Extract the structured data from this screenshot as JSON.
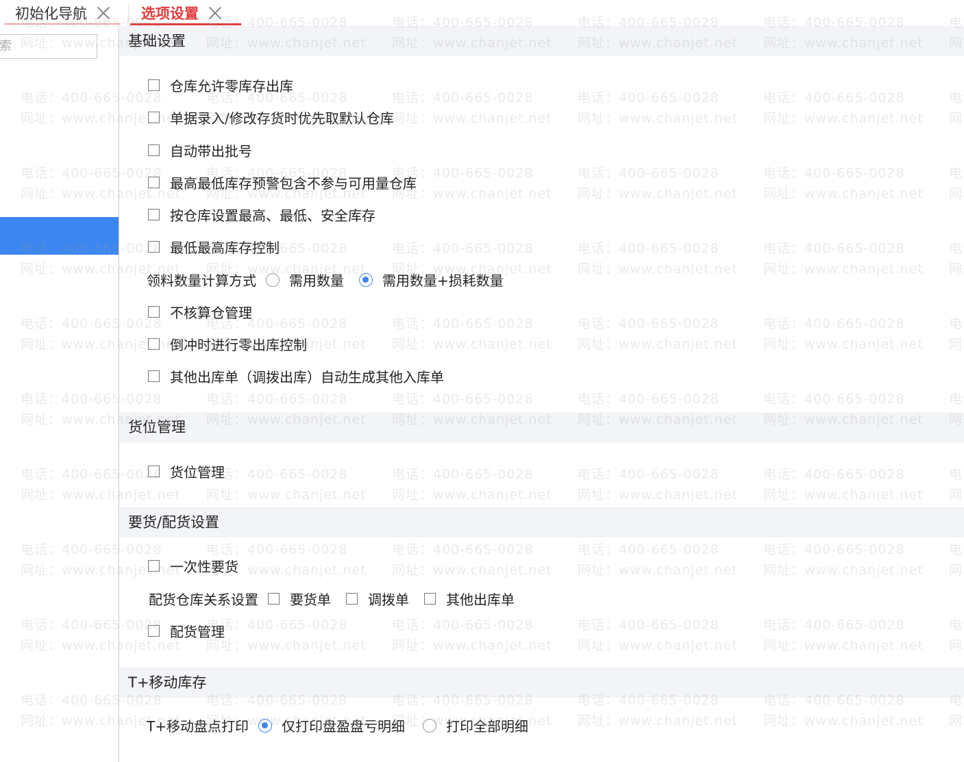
{
  "tabs": [
    {
      "label": "初始化导航"
    },
    {
      "label": "选项设置"
    }
  ],
  "sidebar": {
    "search_placeholder": "索"
  },
  "sections": {
    "basic": {
      "title": "基础设置",
      "options": [
        "仓库允许零库存出库",
        "单据录入/修改存货时优先取默认仓库",
        "自动带出批号",
        "最高最低库存预警包含不参与可用量仓库",
        "按仓库设置最高、最低、安全库存",
        "最低最高库存控制"
      ],
      "calc_method": {
        "label": "领料数量计算方式",
        "options": [
          "需用数量",
          "需用数量+损耗数量"
        ],
        "selected": "需用数量+损耗数量"
      },
      "options2": [
        "不核算仓管理",
        "倒冲时进行零出库控制",
        "其他出库单（调拨出库）自动生成其他入库单"
      ]
    },
    "location": {
      "title": "货位管理",
      "options": [
        "货位管理"
      ]
    },
    "requisition": {
      "title": "要货/配货设置",
      "options": [
        "一次性要货"
      ],
      "relation": {
        "label": "配货仓库关系设置",
        "options": [
          "要货单",
          "调拨单",
          "其他出库单"
        ]
      },
      "options2": [
        "配货管理"
      ]
    },
    "mobile": {
      "title": "T+移动库存",
      "print": {
        "label": "T+移动盘点打印",
        "options": [
          "仅打印盘盈盘亏明细",
          "打印全部明细"
        ],
        "selected": "仅打印盘盈盘亏明细"
      }
    }
  },
  "watermark": {
    "phone": "电话：400-665-0028",
    "site": "网址：www.chanjet.net"
  },
  "colors": {
    "accent": "#3b86f0",
    "active_tab": "#e23b3b",
    "section_bg": "#f2f4f7"
  }
}
